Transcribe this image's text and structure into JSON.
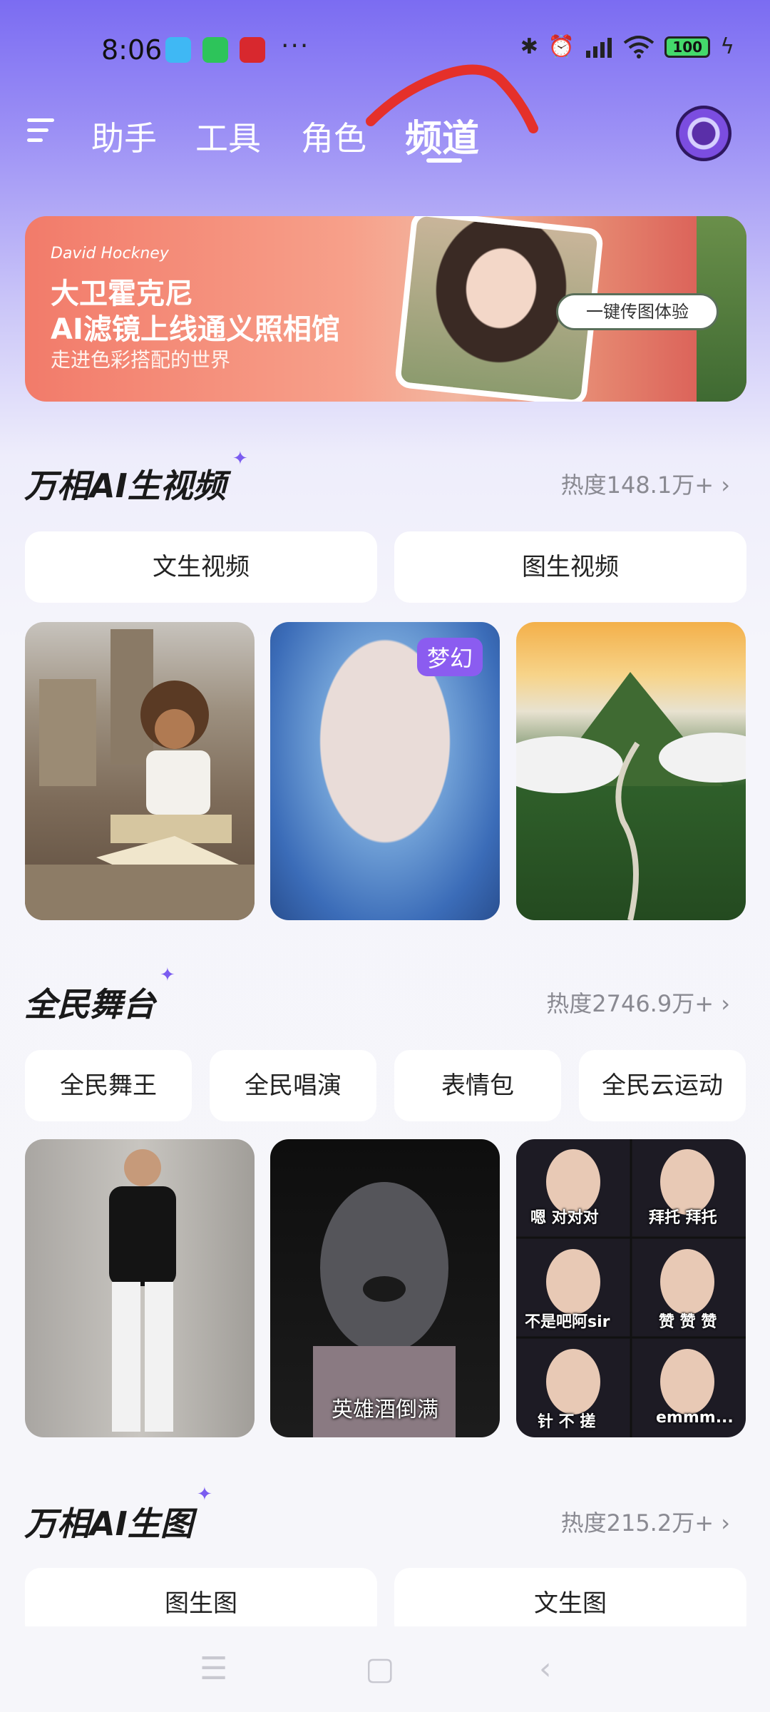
{
  "status_bar": {
    "time": "8:06",
    "more": "···",
    "battery": "100",
    "icons": [
      "bluetooth-icon",
      "alarm-icon",
      "signal-icon",
      "wifi-icon",
      "battery-icon",
      "charging-icon"
    ]
  },
  "nav": {
    "tabs": [
      {
        "label": "助手"
      },
      {
        "label": "工具"
      },
      {
        "label": "角色"
      },
      {
        "label": "频道"
      }
    ],
    "active_tab": "频道"
  },
  "banner": {
    "kicker": "David Hockney",
    "title_line1": "大卫霍克尼",
    "title_line2": "AI滤镜上线通义照相馆",
    "subtitle": "走进色彩搭配的世界",
    "cta": "一键传图体验"
  },
  "sections": [
    {
      "title": "万相AI生视频",
      "heat": "热度148.1万+ ›",
      "pills": [
        "文生视频",
        "图生视频"
      ],
      "cards": [
        {
          "image": "child-reading-in-ruins"
        },
        {
          "image": "blue-hair-girl",
          "tag": "梦幻"
        },
        {
          "image": "mountain-sunrise-road"
        }
      ]
    },
    {
      "title": "全民舞台",
      "heat": "热度2746.9万+ ›",
      "pills": [
        "全民舞王",
        "全民唱演",
        "表情包",
        "全民云运动"
      ],
      "cards": [
        {
          "image": "man-black-shirt-posing"
        },
        {
          "image": "terracotta-warrior",
          "caption": "英雄酒倒满"
        },
        {
          "image": "girl-expressions-grid",
          "captions": [
            "嗯 对对对",
            "拜托 拜托",
            "不是吧阿sir",
            "赞 赞 赞",
            "针 不 搓",
            "emmm..."
          ]
        }
      ]
    },
    {
      "title": "万相AI生图",
      "heat": "热度215.2万+ ›",
      "pills": [
        "图生图",
        "文生图"
      ]
    }
  ],
  "colors": {
    "accent": "#7b5cf0",
    "header_gradient_top": "#7b6cf2",
    "tag_bg": "#8b5cf0"
  }
}
